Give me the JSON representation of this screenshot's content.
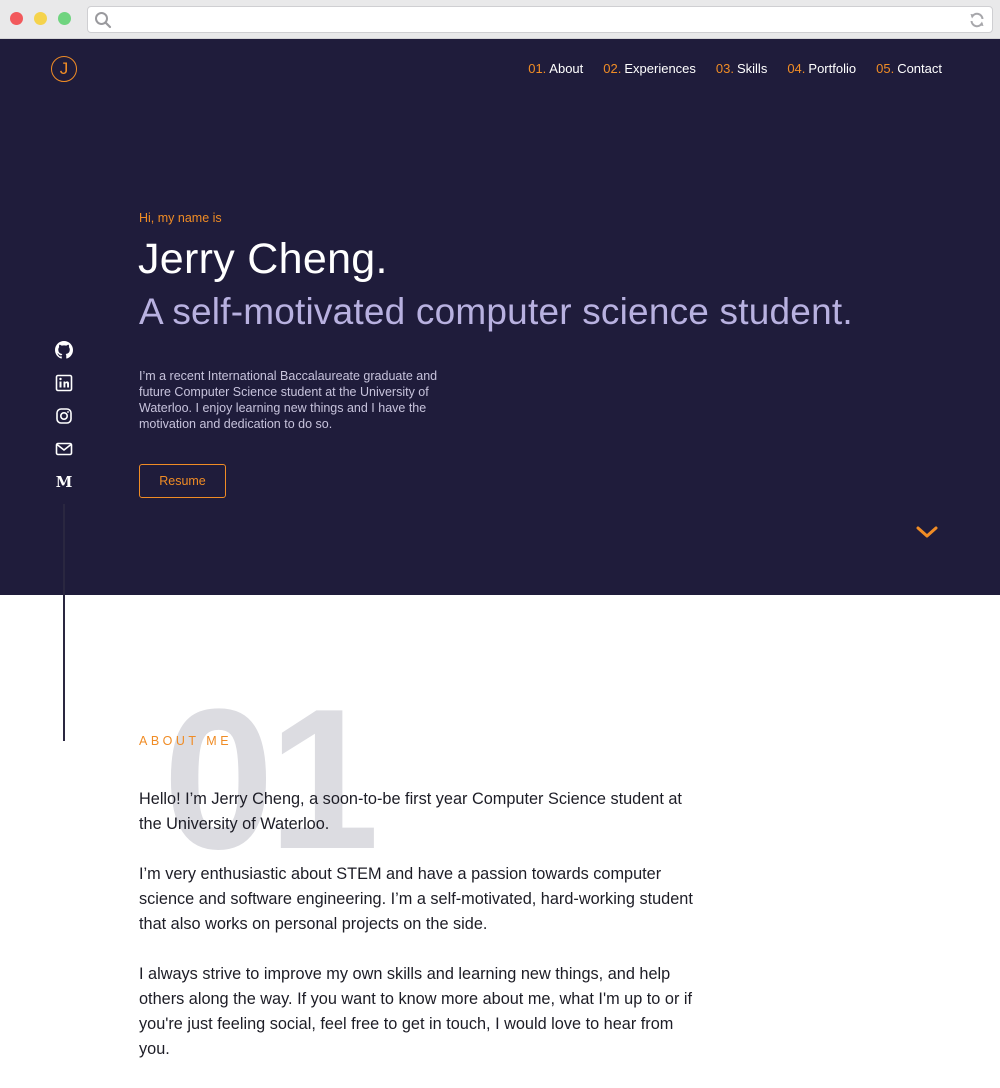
{
  "browser": {
    "address": "",
    "window_buttons": [
      "close",
      "minimize",
      "zoom"
    ]
  },
  "logo": {
    "letter": "J"
  },
  "nav": [
    {
      "num": "01.",
      "label": "About"
    },
    {
      "num": "02.",
      "label": "Experiences"
    },
    {
      "num": "03.",
      "label": "Skills"
    },
    {
      "num": "04.",
      "label": "Portfolio"
    },
    {
      "num": "05.",
      "label": "Contact"
    }
  ],
  "hero": {
    "greeting": "Hi, my name is",
    "name": "Jerry Cheng.",
    "tagline": "A self-motivated computer science student.",
    "bio": "I’m a recent International Baccalaureate graduate and future Computer Science student at the University of Waterloo. I enjoy learning new things and I have the motivation and dedication to do so.",
    "resume_label": "Resume"
  },
  "social": [
    "github-icon",
    "linkedin-icon",
    "instagram-icon",
    "email-icon",
    "medium-icon"
  ],
  "social_medium_glyph": "M",
  "about": {
    "number": "01",
    "label": "ABOUT ME",
    "paragraphs": [
      "Hello! I’m Jerry Cheng, a soon-to-be first year Computer Science student at the University of Waterloo.",
      "I’m very enthusiastic about STEM and have a passion towards computer science and software engineering. I’m a self-motivated, hard-working student that also works on personal projects on the side.",
      "I always strive to improve my own skills and learning new things, and help others along the way. If you want to know more about me, what I'm up to or if you're just feeling social, feel free to get in touch, I would love to hear from you."
    ]
  },
  "colors": {
    "hero_bg": "#1f1c3b",
    "accent": "#f08c25",
    "tagline": "#b8b1e0",
    "big_number": "#dcdce1"
  }
}
